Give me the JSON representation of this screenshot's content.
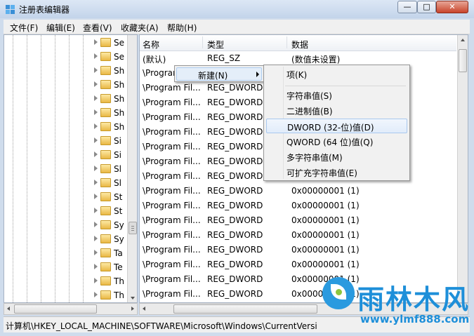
{
  "window": {
    "title": "注册表编辑器",
    "controls": {
      "minimize": "—",
      "maximize": "□",
      "close": "✕"
    }
  },
  "menubar": [
    "文件(F)",
    "编辑(E)",
    "查看(V)",
    "收藏夹(A)",
    "帮助(H)"
  ],
  "tree": {
    "items": [
      "Se",
      "Se",
      "Sh",
      "Sh",
      "Sh",
      "Sh",
      "Sh",
      "Si",
      "Si",
      "Sl",
      "Sl",
      "St",
      "St",
      "Sy",
      "Sy",
      "Ta",
      "Te",
      "Th",
      "Th"
    ]
  },
  "list": {
    "columns": {
      "name": "名称",
      "type": "类型",
      "data": "数据"
    },
    "rows": [
      {
        "name": "(默认)",
        "type": "REG_SZ",
        "data": "(数值未设置)"
      },
      {
        "name": "\\Program Fil...",
        "type": "REG_DWORD",
        "data": ""
      },
      {
        "name": "\\Program Fil...",
        "type": "REG_DWORD",
        "data": ""
      },
      {
        "name": "\\Program Fil...",
        "type": "REG_DWORD",
        "data": ""
      },
      {
        "name": "\\Program Fil...",
        "type": "REG_DWORD",
        "data": ""
      },
      {
        "name": "\\Program Fil...",
        "type": "REG_DWORD",
        "data": ""
      },
      {
        "name": "\\Program Fil...",
        "type": "REG_DWORD",
        "data": ""
      },
      {
        "name": "\\Program Fil...",
        "type": "REG_DWORD",
        "data": ""
      },
      {
        "name": "\\Program Fil...",
        "type": "REG_DWORD",
        "data": ""
      },
      {
        "name": "\\Program Fil...",
        "type": "REG_DWORD",
        "data": "0x00000001 (1)"
      },
      {
        "name": "\\Program Fil...",
        "type": "REG_DWORD",
        "data": "0x00000001 (1)"
      },
      {
        "name": "\\Program Fil...",
        "type": "REG_DWORD",
        "data": "0x00000001 (1)"
      },
      {
        "name": "\\Program Fil...",
        "type": "REG_DWORD",
        "data": "0x00000001 (1)"
      },
      {
        "name": "\\Program Fil...",
        "type": "REG_DWORD",
        "data": "0x00000001 (1)"
      },
      {
        "name": "\\Program Fil...",
        "type": "REG_DWORD",
        "data": "0x00000001 (1)"
      },
      {
        "name": "\\Program Fil...",
        "type": "REG_DWORD",
        "data": "0x00000001 (1)"
      },
      {
        "name": "\\Program Fil...",
        "type": "REG_DWORD",
        "data": "0x00000001 (1)"
      },
      {
        "name": "\\Program Fil...",
        "type": "REG_DWORD",
        "data": "0x00000001 (1)"
      }
    ]
  },
  "context_menu": {
    "parent": "新建(N)",
    "items": [
      "项(K)",
      "字符串值(S)",
      "二进制值(B)",
      "DWORD (32-位)值(D)",
      "QWORD (64 位)值(Q)",
      "多字符串值(M)",
      "可扩充字符串值(E)"
    ],
    "highlighted": "DWORD (32-位)值(D)"
  },
  "statusbar": "计算机\\HKEY_LOCAL_MACHINE\\SOFTWARE\\Microsoft\\Windows\\CurrentVersi",
  "watermark": {
    "name": "雨林木风",
    "url": "www.ylmf888.com"
  },
  "colors": {
    "accent": "#1e8fd9",
    "highlight": "#e4eef9",
    "window_frame": "#cfdcec"
  }
}
